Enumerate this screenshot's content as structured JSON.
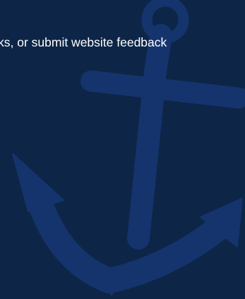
{
  "panel": {
    "background_color": "#0d2547",
    "watermark_color": "#15346d",
    "feedback_text": "ks, or submit website feedback"
  },
  "icons": {
    "watermark": "anchor-icon"
  }
}
